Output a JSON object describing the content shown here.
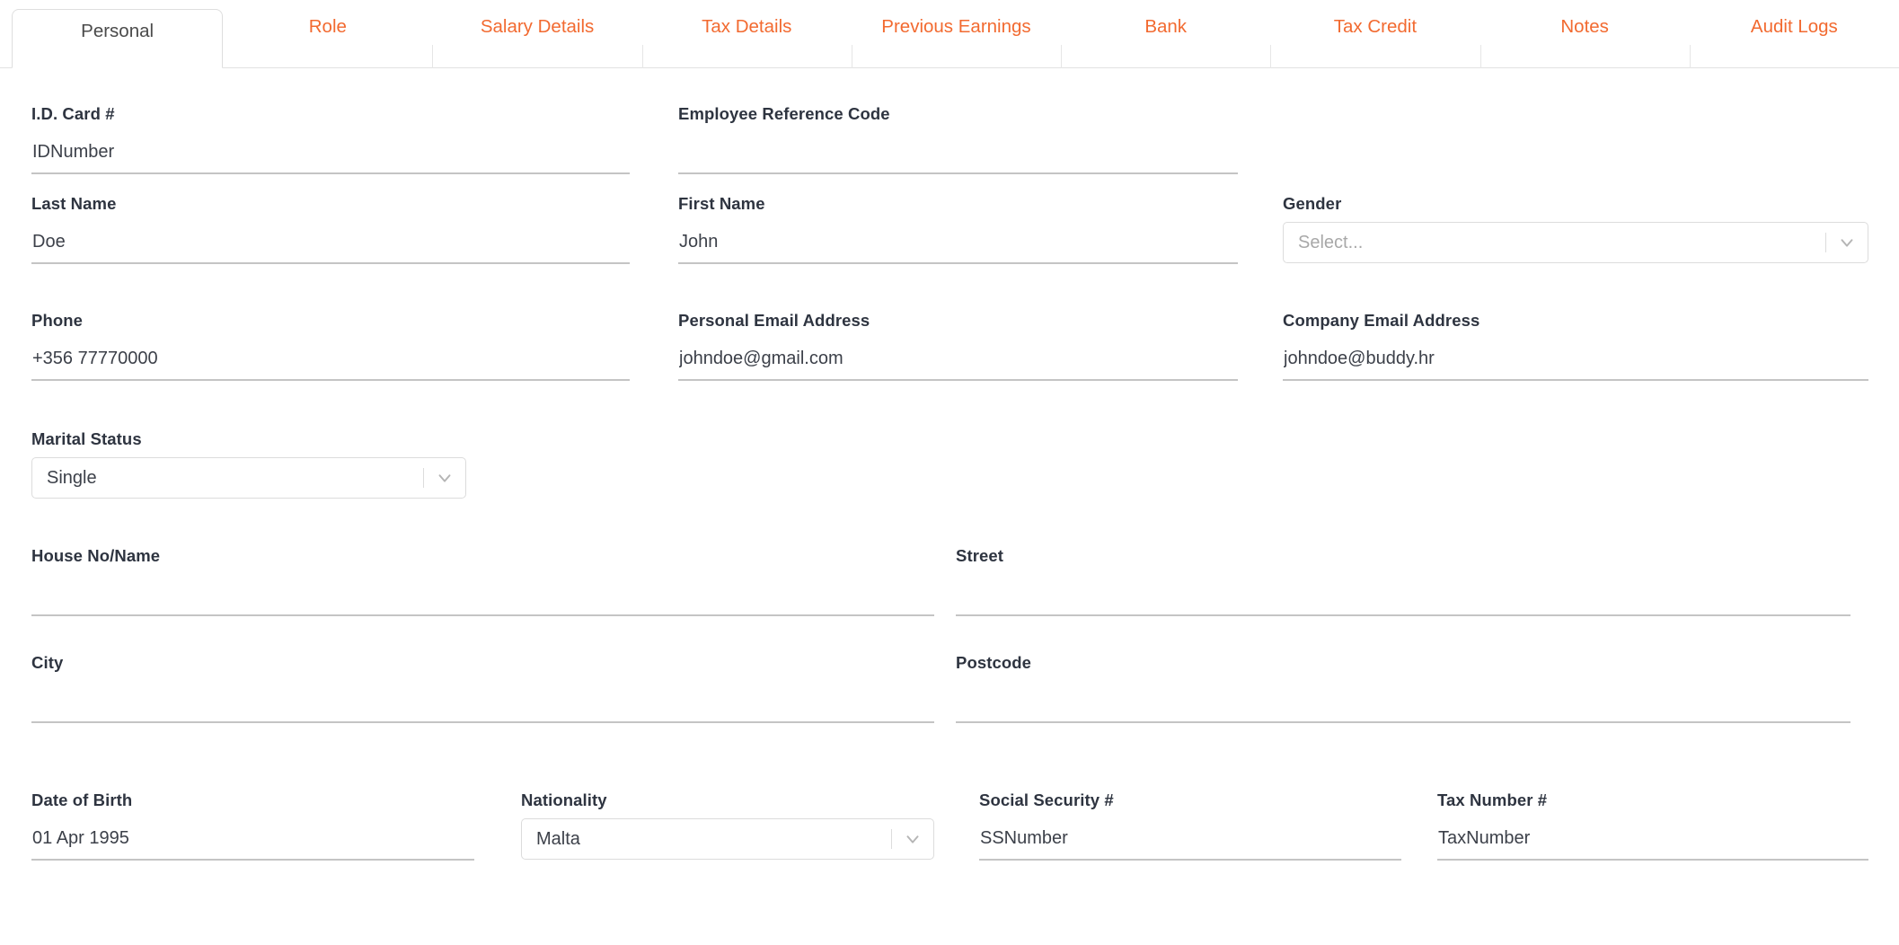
{
  "theme": {
    "accent": "#f26a30",
    "active_tab_text": "#4a4a4a",
    "label_color": "#2e3440",
    "value_color": "#3c4049",
    "underline_color": "#c4c4c4",
    "border_color": "#dcdcdc"
  },
  "tabs": [
    {
      "label": "Personal",
      "active": true
    },
    {
      "label": "Role",
      "active": false
    },
    {
      "label": "Salary Details",
      "active": false
    },
    {
      "label": "Tax Details",
      "active": false
    },
    {
      "label": "Previous Earnings",
      "active": false
    },
    {
      "label": "Bank",
      "active": false
    },
    {
      "label": "Tax Credit",
      "active": false
    },
    {
      "label": "Notes",
      "active": false
    },
    {
      "label": "Audit Logs",
      "active": false
    }
  ],
  "form": {
    "id_card": {
      "label": "I.D. Card #",
      "value": "IDNumber",
      "placeholder": ""
    },
    "employee_reference_code": {
      "label": "Employee Reference Code",
      "value": "",
      "placeholder": ""
    },
    "last_name": {
      "label": "Last Name",
      "value": "Doe",
      "placeholder": ""
    },
    "first_name": {
      "label": "First Name",
      "value": "John",
      "placeholder": ""
    },
    "gender": {
      "label": "Gender",
      "value": "Select...",
      "is_placeholder": true
    },
    "phone": {
      "label": "Phone",
      "value": "+356 77770000",
      "placeholder": ""
    },
    "personal_email": {
      "label": "Personal Email Address",
      "value": "johndoe@gmail.com",
      "placeholder": ""
    },
    "company_email": {
      "label": "Company Email Address",
      "value": "johndoe@buddy.hr",
      "placeholder": ""
    },
    "marital_status": {
      "label": "Marital Status",
      "value": "Single",
      "is_placeholder": false
    },
    "house_no_name": {
      "label": "House No/Name",
      "value": "",
      "placeholder": ""
    },
    "street": {
      "label": "Street",
      "value": "",
      "placeholder": ""
    },
    "city": {
      "label": "City",
      "value": "",
      "placeholder": ""
    },
    "postcode": {
      "label": "Postcode",
      "value": "",
      "placeholder": ""
    },
    "date_of_birth": {
      "label": "Date of Birth",
      "value": "01 Apr 1995",
      "placeholder": ""
    },
    "nationality": {
      "label": "Nationality",
      "value": "Malta",
      "is_placeholder": false
    },
    "social_security": {
      "label": "Social Security #",
      "value": "SSNumber",
      "placeholder": ""
    },
    "tax_number": {
      "label": "Tax Number #",
      "value": "TaxNumber",
      "placeholder": ""
    }
  },
  "icons": {
    "chevron_down": "chevron-down-icon"
  }
}
